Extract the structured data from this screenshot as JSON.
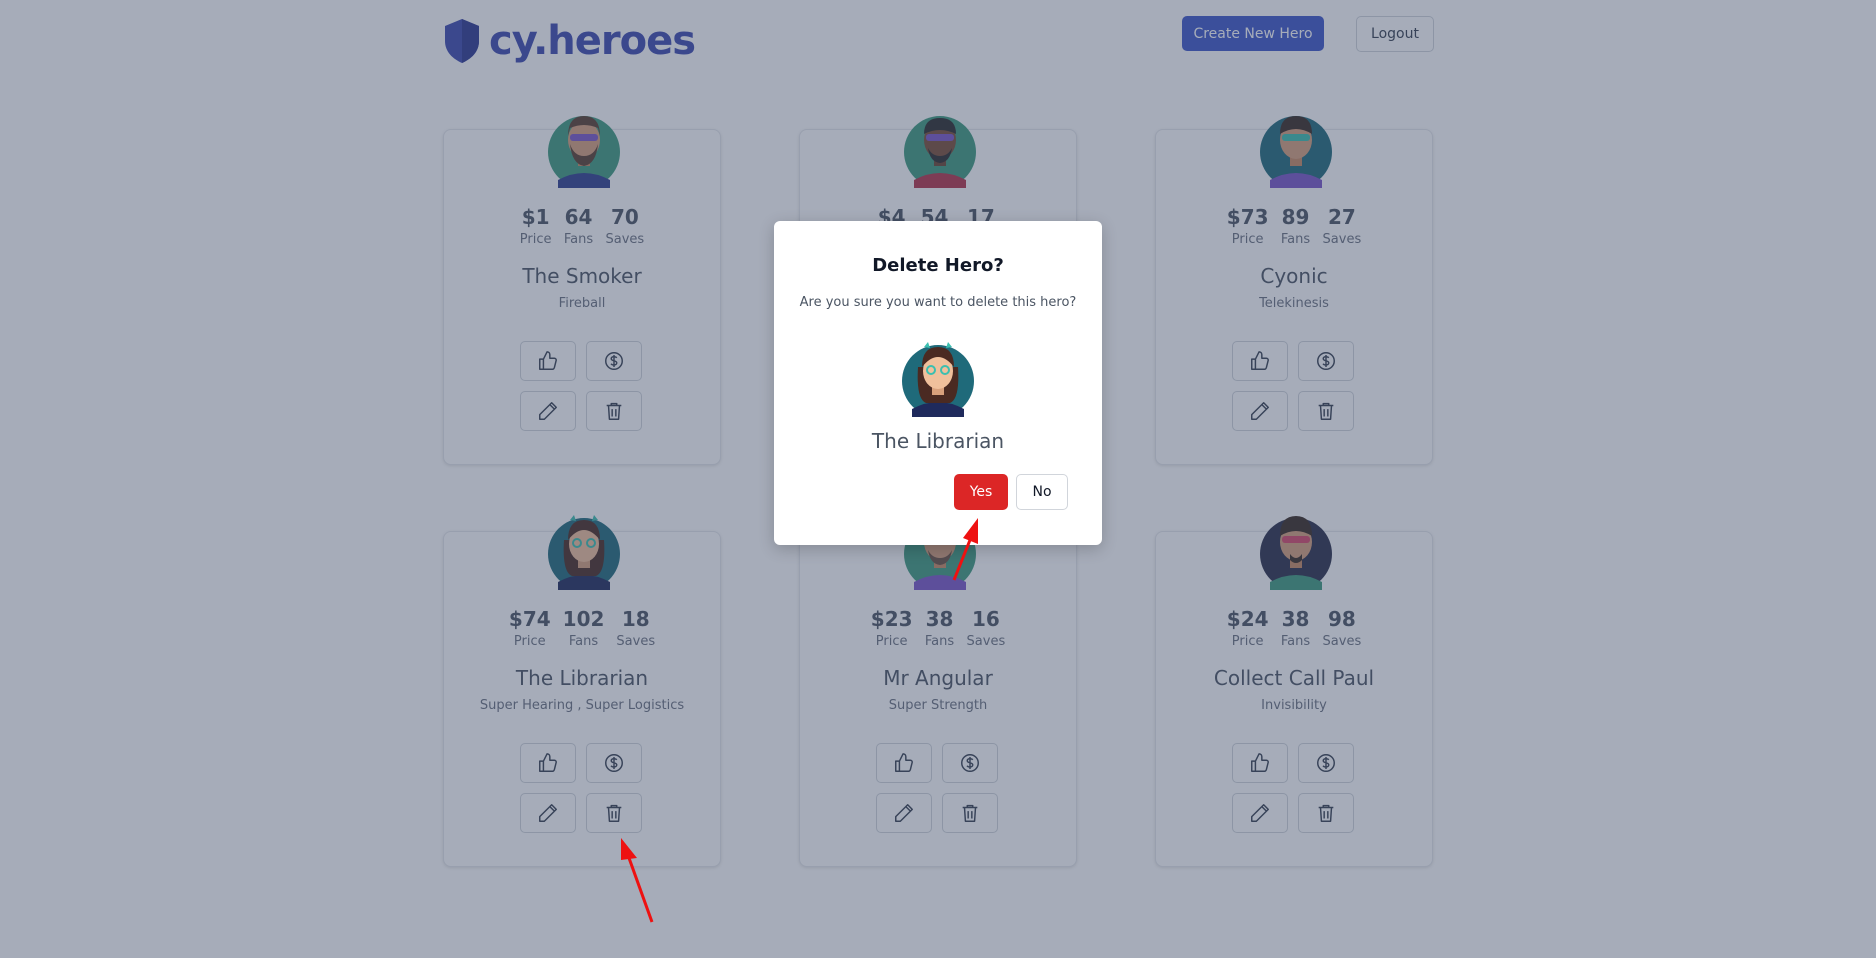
{
  "header": {
    "logo_text": "cy.heroes",
    "create_label": "Create New Hero",
    "logout_label": "Logout"
  },
  "stat_labels": {
    "price": "Price",
    "fans": "Fans",
    "saves": "Saves"
  },
  "heroes": [
    {
      "name": "The Smoker",
      "power": "Fireball",
      "price": "$1",
      "fans": "64",
      "saves": "70"
    },
    {
      "name": "",
      "power": "",
      "price": "$4",
      "fans": "54",
      "saves": "17"
    },
    {
      "name": "Cyonic",
      "power": "Telekinesis",
      "price": "$73",
      "fans": "89",
      "saves": "27"
    },
    {
      "name": "The Librarian",
      "power": "Super Hearing ,  Super Logistics",
      "price": "$74",
      "fans": "102",
      "saves": "18"
    },
    {
      "name": "Mr Angular",
      "power": "Super Strength",
      "price": "$23",
      "fans": "38",
      "saves": "16"
    },
    {
      "name": "Collect Call Paul",
      "power": "Invisibility",
      "price": "$24",
      "fans": "38",
      "saves": "98"
    }
  ],
  "modal": {
    "title": "Delete Hero?",
    "message": "Are you sure you want to delete this hero?",
    "hero_name": "The Librarian",
    "yes_label": "Yes",
    "no_label": "No"
  },
  "colors": {
    "brand": "#3d4ab0",
    "primary_button": "#3d56c8",
    "danger_button": "#dc2626",
    "annotation_arrow": "#ee1111"
  },
  "icons": [
    "shield-icon",
    "thumbs-up-icon",
    "dollar-circle-icon",
    "pencil-icon",
    "trash-icon"
  ]
}
